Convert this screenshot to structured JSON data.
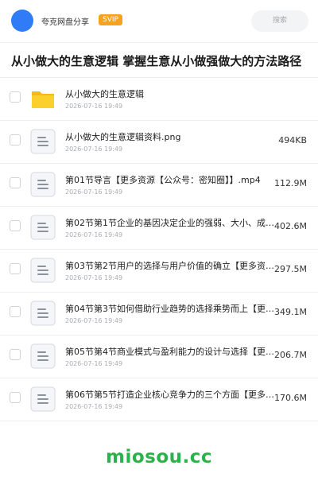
{
  "header": {
    "sharer_name": "夸克网盘分享",
    "badge": "SVIP",
    "search_placeholder": "搜索",
    "avatar_color": "#2f7cf6",
    "badge_color": "#f6a21e"
  },
  "folder_title": "从小做大的生意逻辑 掌握生意从小做强做大的方法路径",
  "files": [
    {
      "name": "从小做大的生意逻辑",
      "date": "2026-07-16 19:49",
      "size": "",
      "icon": "folder-icon"
    },
    {
      "name": "从小做大的生意逻辑资料.png",
      "date": "2026-07-16 19:49",
      "size": "494KB",
      "icon": "file-icon"
    },
    {
      "name": "第01节导言【更多资源【公众号：密知圈】】.mp4",
      "date": "2026-07-16 19:49",
      "size": "112.9M",
      "icon": "file-icon"
    },
    {
      "name": "第02节第1节企业的基因决定企业的强弱、大小、成败…",
      "date": "2026-07-16 19:49",
      "size": "402.6M",
      "icon": "file-icon"
    },
    {
      "name": "第03节第2节用户的选择与用户价值的确立【更多资源…",
      "date": "2026-07-16 19:49",
      "size": "297.5M",
      "icon": "file-icon"
    },
    {
      "name": "第04节第3节如何借助行业趋势的选择乘势而上【更多…",
      "date": "2026-07-16 19:49",
      "size": "349.1M",
      "icon": "file-icon"
    },
    {
      "name": "第05节第4节商业模式与盈利能力的设计与选择【更多…",
      "date": "2026-07-16 19:49",
      "size": "206.7M",
      "icon": "file-icon"
    },
    {
      "name": "第06节第5节打造企业核心竞争力的三个方面【更多资…",
      "date": "2026-07-16 19:49",
      "size": "170.6M",
      "icon": "file-icon"
    }
  ],
  "footer": {
    "brand": "miosou.cc",
    "brand_color": "#29b34a"
  }
}
